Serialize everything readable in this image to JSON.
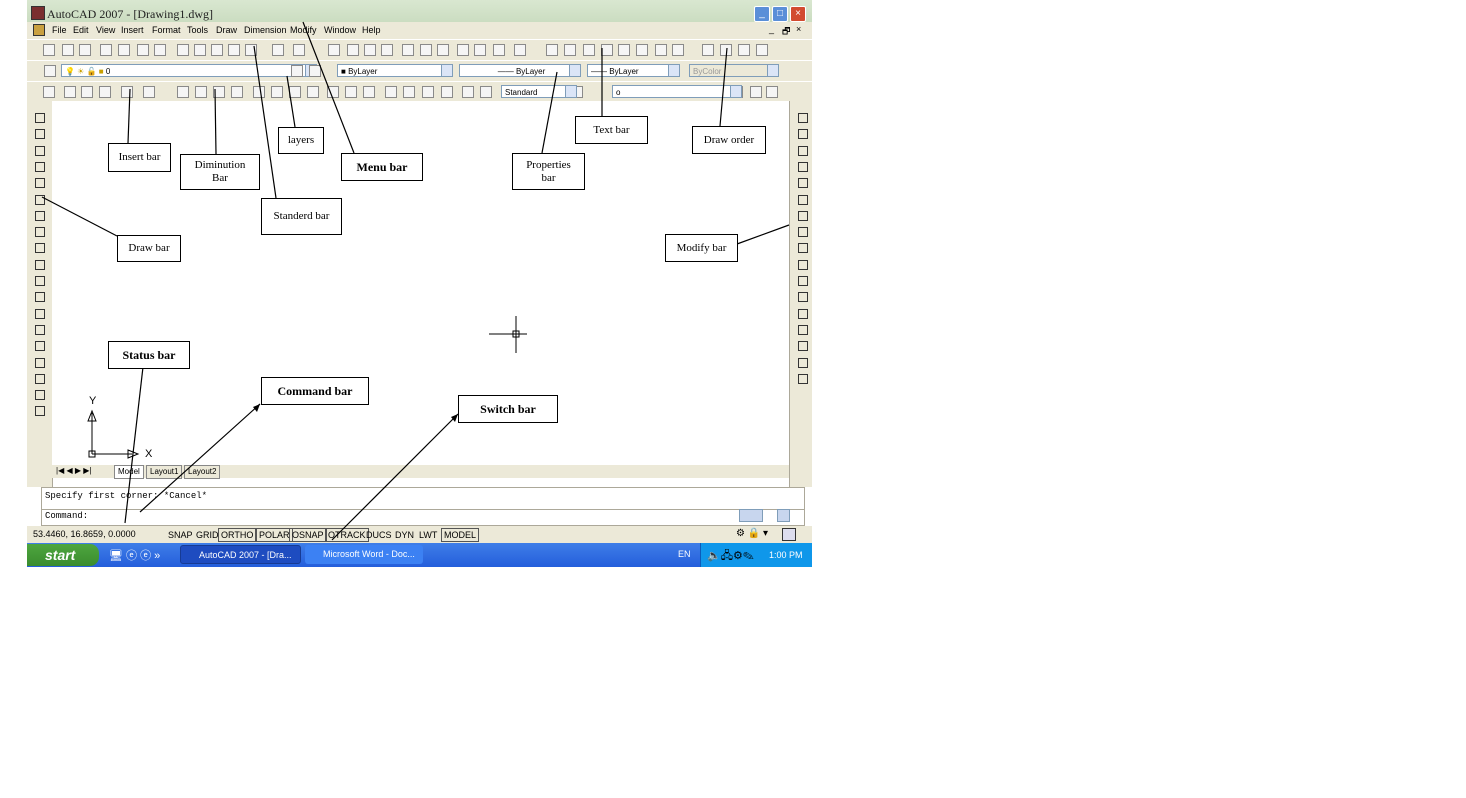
{
  "window": {
    "title": "AutoCAD 2007 - [Drawing1.dwg]",
    "minimize": "_",
    "maximize": "□",
    "close": "×"
  },
  "menu": {
    "items": [
      "File",
      "Edit",
      "View",
      "Insert",
      "Format",
      "Tools",
      "Draw",
      "Dimension",
      "Modify",
      "Window",
      "Help"
    ],
    "mdi": [
      "_",
      "🗗",
      "×"
    ]
  },
  "properties": {
    "layer": "0",
    "color": "ByLayer",
    "linetype": "ByLayer",
    "lineweight": "ByLayer",
    "plotstyle": "ByColor"
  },
  "styles": {
    "dimstyle": "Standard",
    "text_value": "o"
  },
  "tabs": [
    "Model",
    "Layout1",
    "Layout2"
  ],
  "command": {
    "history": "Specify first corner: *Cancel*",
    "prompt": "Command:"
  },
  "status": {
    "coords": "53.4460, 16.8659, 0.0000",
    "toggles": [
      "SNAP",
      "GRID",
      "ORTHO",
      "POLAR",
      "OSNAP",
      "OTRACK",
      "DUCS",
      "DYN",
      "LWT",
      "MODEL"
    ]
  },
  "taskbar": {
    "start": "start",
    "items": [
      "AutoCAD 2007 - [Dra...",
      "Microsoft Word - Doc..."
    ],
    "lang": "EN",
    "time": "1:00 PM"
  },
  "ucs": {
    "x": "X",
    "y": "Y"
  },
  "callouts": {
    "insert_bar": "Insert bar",
    "diminution_bar": "Diminution Bar",
    "layers": "layers",
    "menu_bar": "Menu bar",
    "properties_bar": "Properties bar",
    "text_bar": "Text bar",
    "draw_order": "Draw order",
    "standerd_bar": "Standerd bar",
    "draw_bar": "Draw bar",
    "modify_bar": "Modify bar",
    "status_bar": "Status bar",
    "command_bar": "Command bar",
    "switch_bar": "Switch bar"
  }
}
